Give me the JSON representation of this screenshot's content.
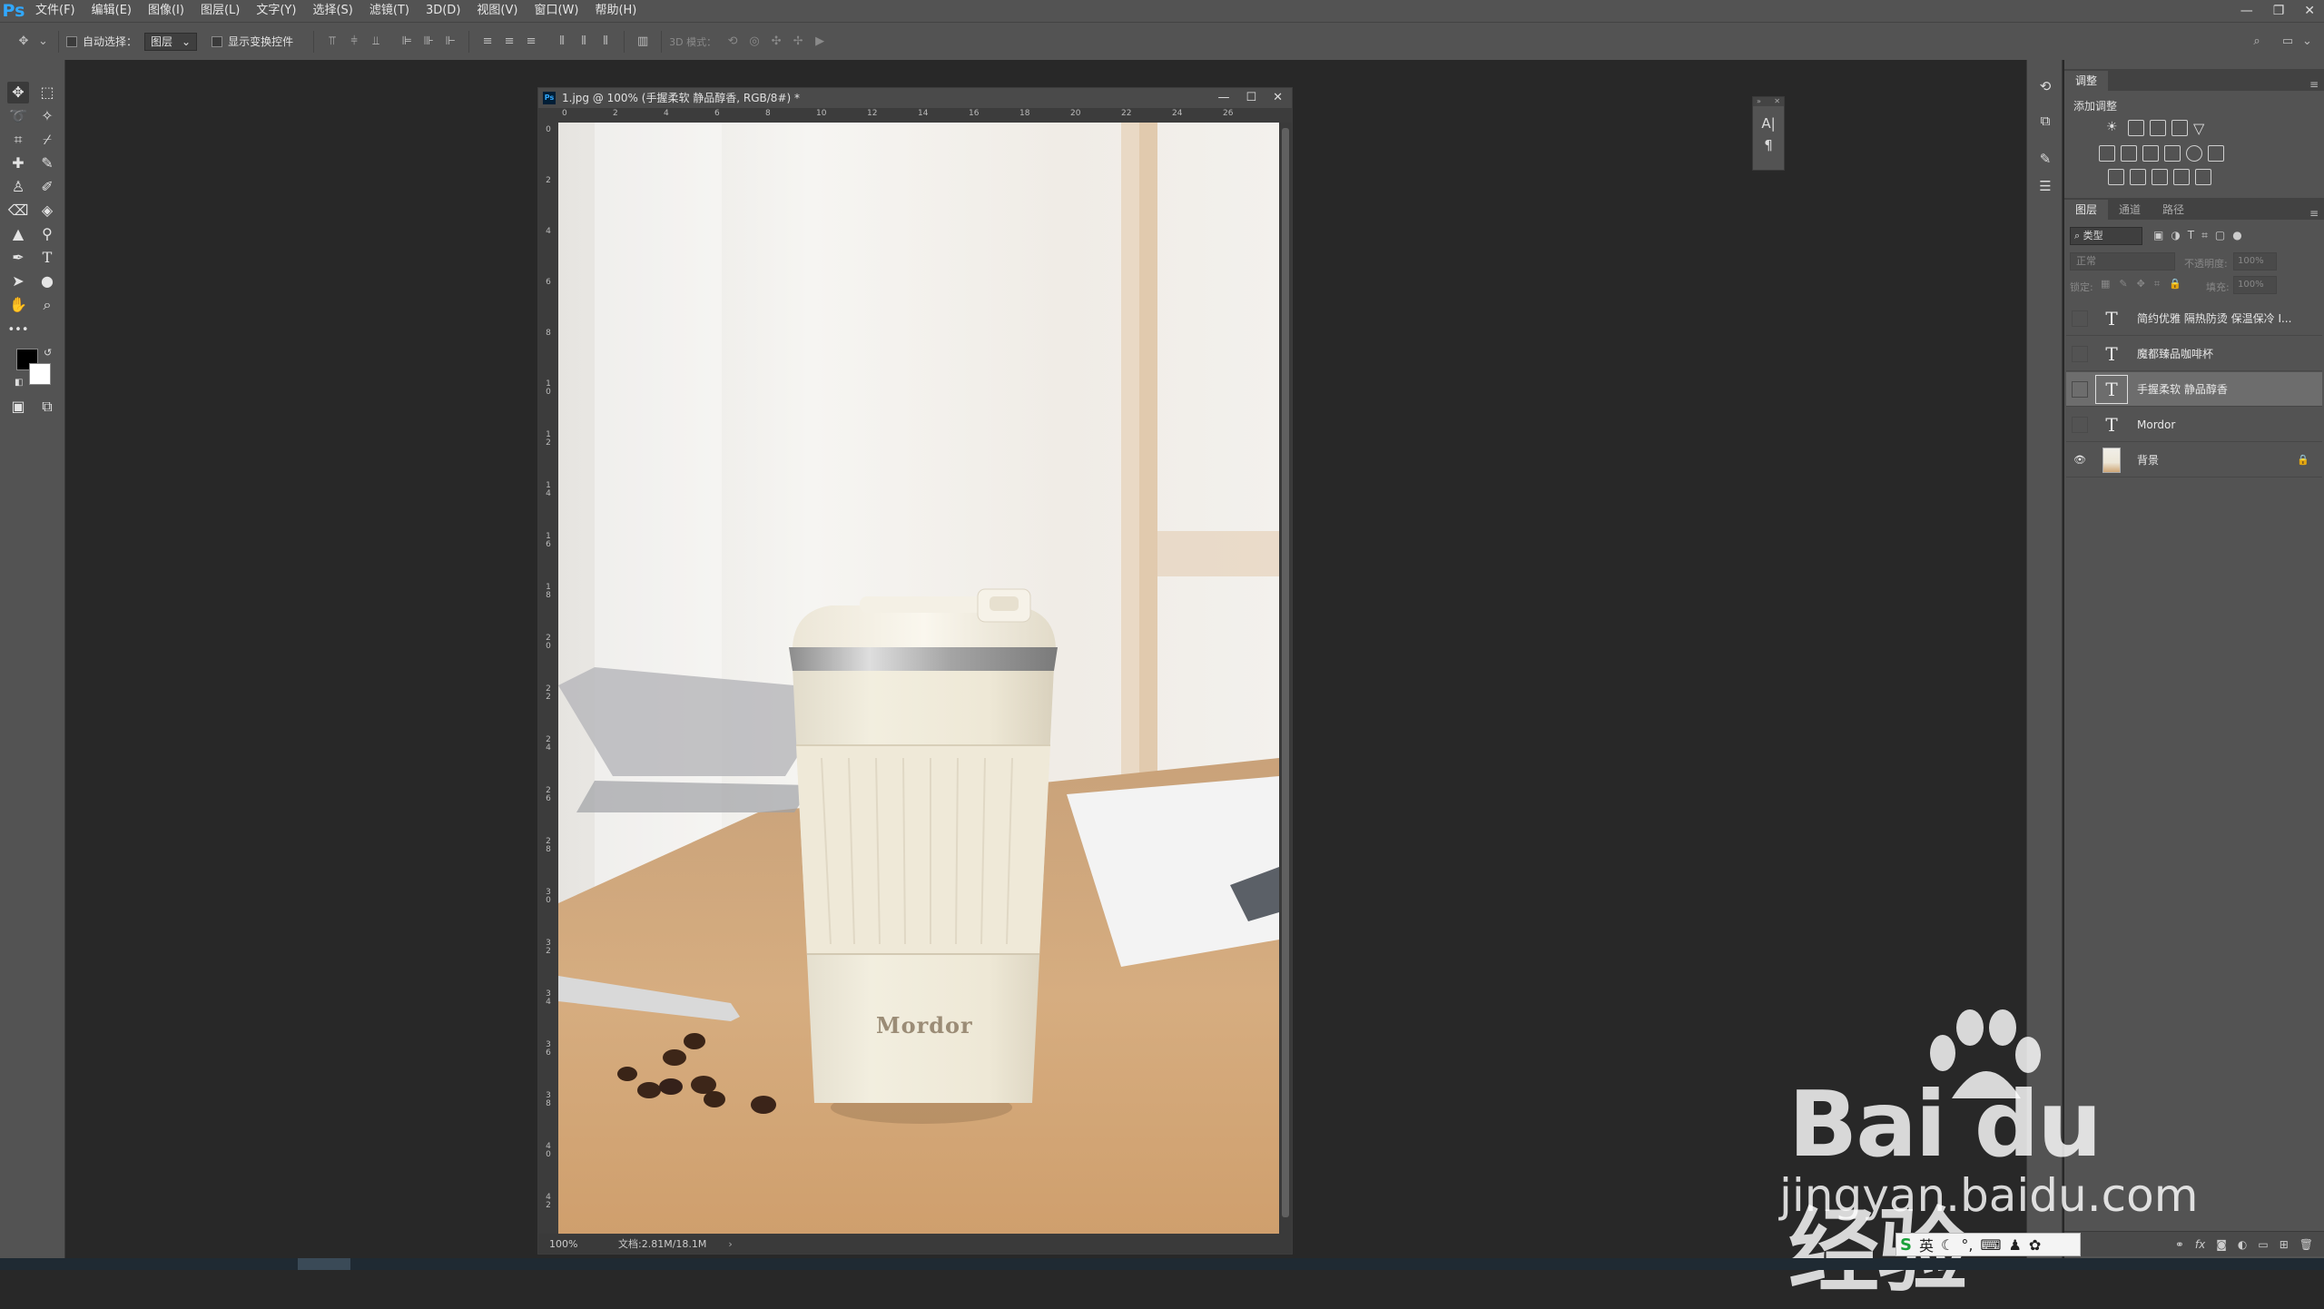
{
  "app": {
    "logo": "Ps",
    "menu": [
      "文件(F)",
      "编辑(E)",
      "图像(I)",
      "图层(L)",
      "文字(Y)",
      "选择(S)",
      "滤镜(T)",
      "3D(D)",
      "视图(V)",
      "窗口(W)",
      "帮助(H)"
    ]
  },
  "options": {
    "auto_select_label": "自动选择：",
    "auto_select_target": "图层",
    "show_transform_label": "显示变换控件",
    "mode_3d_label": "3D 模式："
  },
  "document": {
    "tab_title": "1.jpg @ 100% (手握柔软 静品醇香, RGB/8#) *",
    "zoom": "100%",
    "doc_size": "文档:2.81M/18.1M",
    "ruler_top": [
      "0",
      "2",
      "4",
      "6",
      "8",
      "10",
      "12",
      "14",
      "16",
      "18",
      "20",
      "22",
      "24",
      "26"
    ],
    "ruler_left": [
      "0",
      "2",
      "4",
      "6",
      "8",
      "10",
      "12",
      "14",
      "16",
      "18",
      "20",
      "22",
      "24",
      "26",
      "28",
      "30",
      "32",
      "34",
      "36",
      "38",
      "40",
      "42"
    ],
    "photo_brand": "Mordor"
  },
  "panels": {
    "adjustments_tab": "调整",
    "add_adjustment": "添加调整",
    "layers_tabs": [
      "图层",
      "通道",
      "路径"
    ],
    "filter_kind": "类型",
    "blend_mode": "正常",
    "opacity_label": "不透明度:",
    "opacity_value": "100%",
    "lock_label": "锁定:",
    "fill_label": "填充:",
    "fill_value": "100%",
    "layers": [
      {
        "name": "简约优雅 隔热防烫 保温保冷 I...",
        "type": "text",
        "visible": false,
        "selected": false
      },
      {
        "name": "魔都臻品咖啡杯",
        "type": "text",
        "visible": false,
        "selected": false
      },
      {
        "name": "手握柔软 静品醇香",
        "type": "text",
        "visible": false,
        "selected": true
      },
      {
        "name": "Mordor",
        "type": "text",
        "visible": false,
        "selected": false
      },
      {
        "name": "背景",
        "type": "image",
        "visible": true,
        "selected": false,
        "locked": true
      }
    ]
  },
  "watermark": {
    "main": "Bai du 经验",
    "sub": "jingyan.baidu.com"
  },
  "ime": {
    "lang": "英"
  },
  "colors": {
    "ui_bg": "#535353",
    "workspace": "#282828",
    "accent": "#31a8ff"
  }
}
